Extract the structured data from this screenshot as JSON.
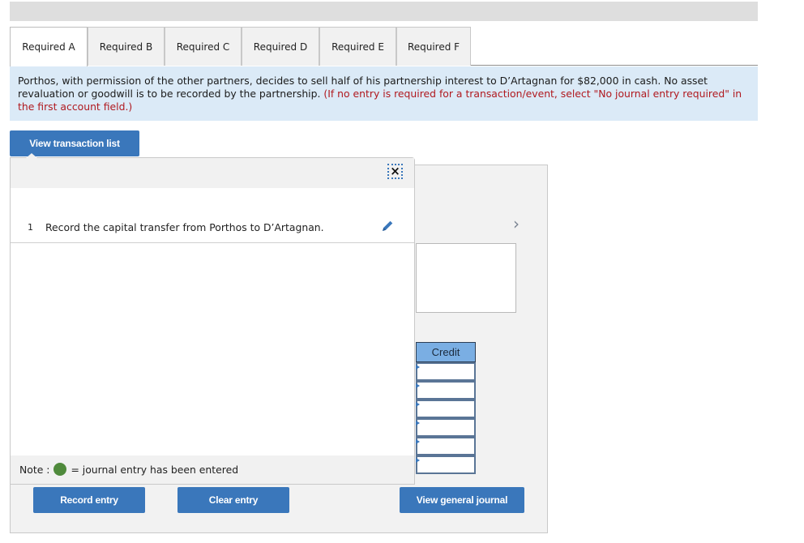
{
  "tabs": [
    {
      "label": "Required A",
      "active": true
    },
    {
      "label": "Required B",
      "active": false
    },
    {
      "label": "Required C",
      "active": false
    },
    {
      "label": "Required D",
      "active": false
    },
    {
      "label": "Required E",
      "active": false
    },
    {
      "label": "Required F",
      "active": false
    }
  ],
  "prompt": {
    "text": "Porthos, with permission of the other partners, decides to sell half of his partnership interest to D’Artagnan for $82,000 in cash. No asset revaluation or goodwill is to be recorded by the partnership.",
    "hint": "(If no entry is required for a transaction/event, select \"No journal entry required\" in the first account field.)"
  },
  "buttons": {
    "view_transaction_list": "View transaction list",
    "record_entry": "Record entry",
    "clear_entry": "Clear entry",
    "view_general_journal": "View general journal"
  },
  "popup": {
    "close_icon": "×",
    "transactions": [
      {
        "number": "1",
        "description": "Record the capital transfer from Porthos to D’Artagnan."
      }
    ],
    "note_label": "Note :",
    "note_text": "= journal entry has been entered"
  },
  "journal": {
    "next_icon": "›",
    "credit_header": "Credit",
    "credit_values": [
      "",
      "",
      "",
      "",
      "",
      ""
    ]
  },
  "colors": {
    "accent": "#3a77bb",
    "prompt_bg": "#dbeaf7",
    "hint": "#b0191f",
    "entered_dot": "#4f8a3c",
    "credit_header_bg": "#7aaee3"
  }
}
